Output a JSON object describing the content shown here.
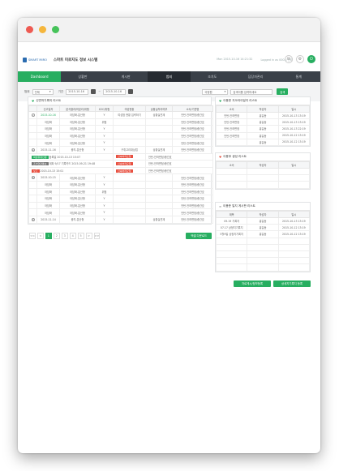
{
  "header": {
    "app_title": "스마트 미로지도 정보 시스템",
    "logo_text": "SMART MIRO",
    "user_info": "Mon 2015-10-16 14:21:32",
    "login_info": "Logged in as 000시 관리"
  },
  "nav": [
    "Dashboard",
    "상황판",
    "게시판",
    "범죄",
    "조치도",
    "담당자관리",
    "통계"
  ],
  "filters": {
    "field_label": "범위",
    "field_value": "전체",
    "period_label": "기간",
    "date_from": "2015-10-16",
    "date_to": "2015-10-16",
    "sep": "~",
    "cat_value": "국정원",
    "search_placeholder": "검색어를 입력하세요",
    "search_button": "검색"
  },
  "main_panel": {
    "title": "신변처기록의 리스트",
    "columns": [
      "신고일자",
      "분석결과/미분리/위험",
      "X2C/위험",
      "여성현황",
      "상황실처리여부",
      "소속/기관명"
    ],
    "rows": [
      [
        "2015-10-16",
        "아담화-분산형",
        "Y",
        "여성범 현황 입력하기",
        "상황실연계",
        "안탄-안하면정/중간호"
      ],
      [
        "아담화",
        "아담화-분산형",
        "위험",
        "",
        "",
        "안탄-안하면정/중간호"
      ],
      [
        "아담화",
        "아담화-분산형",
        "Y",
        "",
        "",
        "안탄-안하면정/중간호"
      ],
      [
        "아담화",
        "아담화-분산형",
        "Y",
        "",
        "",
        "안탄-안하면정/중간호"
      ],
      [
        "아담화",
        "아담화-분산형",
        "Y",
        "",
        "",
        "안탄-안하면정/중간호"
      ],
      [
        "2015-11-16",
        "중지-분산형",
        "Y",
        "구취고리대상업",
        "상황실연계",
        "안탄-안하면정/중간호"
      ]
    ],
    "detail": [
      {
        "tag": "여성유령인원",
        "text": "등록일 2015-10-13 15:07",
        "status": "신속처리요청",
        "org": "안탄-안하면정/중간호"
      },
      {
        "tag": "조치연관통보",
        "text": "계획 9/17 기록카드 2015-09-21 19:48",
        "status": "신속처리요청",
        "org": "안탄-안하면정/중간호"
      },
      {
        "tag": "보고",
        "text": "2015-10-13 15:01",
        "status": "신속처리요청",
        "org": "안탄-안하면정/중간호"
      }
    ],
    "rows2": [
      [
        "2015-10-15",
        "아담화-분산형",
        "Y",
        "",
        "",
        "안탄-안하면정/중간호"
      ],
      [
        "아담화",
        "아담화-분산형",
        "Y",
        "",
        "",
        "안탄-안하면정/중간호"
      ],
      [
        "아담화",
        "아담화-분산형",
        "위험",
        "",
        "",
        "안탄-안하면정/중간호"
      ],
      [
        "아담화",
        "아담화-분산형",
        "Y",
        "",
        "",
        "안탄-안하면정/중간호"
      ],
      [
        "아담화",
        "아담화-분산형",
        "Y",
        "",
        "",
        "안탄-안하면정/중간호"
      ],
      [
        "아담화",
        "아담화-분산형",
        "Y",
        "",
        "",
        "안탄-안하면정/중간호"
      ],
      [
        "2015-11-14",
        "중지-분산형",
        "Y",
        "",
        "상황실연계",
        "안탄-안하면정/중간호"
      ]
    ],
    "pages": [
      "<<",
      "<",
      "1",
      "2",
      "3",
      "4",
      "5",
      ">",
      ">>"
    ],
    "excel_button": "엑셀 다운로드"
  },
  "panel_a": {
    "title": "이용준 지오라이일지 리스트",
    "columns": [
      "소속",
      "작성자",
      "일시"
    ],
    "rows": [
      [
        "안탄-안하면정",
        "홍길동",
        "2015-10-13 13:19"
      ],
      [
        "안탄-안하면정",
        "홍길동",
        "2015-10-13 13:19"
      ],
      [
        "안탄-안하면정",
        "홍길동",
        "2015-10-13 22:19"
      ],
      [
        "안탄-안하면정",
        "홍길동",
        "2015-10-12 13:19"
      ],
      [
        "",
        "홍길동",
        "2015-10-12 13:19"
      ]
    ]
  },
  "panel_b": {
    "title": "이용후 생성 리스트",
    "columns": [
      "소속",
      "작성자",
      "일시"
    ],
    "rows": [
      [
        "",
        "",
        ""
      ],
      [
        "",
        "",
        ""
      ],
      [
        "",
        "",
        ""
      ]
    ]
  },
  "panel_c": {
    "title": "이용준 일지 게시판 리스트",
    "columns": [
      "제목",
      "작성자",
      "일시"
    ],
    "rows": [
      [
        "09.19 기록지",
        "홍길동",
        "2015-10-13 13:19"
      ],
      [
        "07.17 상정지기록지",
        "홍길동",
        "2015-10-12 13:19"
      ],
      [
        "5월9일 상정지기록지",
        "홍길동",
        "2015-10-12 13:19"
      ],
      [
        "",
        "",
        ""
      ],
      [
        "",
        "",
        ""
      ],
      [
        "",
        "",
        ""
      ],
      [
        "",
        "",
        ""
      ],
      [
        "",
        "",
        ""
      ]
    ]
  },
  "right_buttons": {
    "report": "자료게시/정보등록",
    "detail": "상세지기록지 등록"
  },
  "colors": {
    "green": "#27ae60",
    "nav": "#3a4048",
    "red": "#e74c3c"
  }
}
